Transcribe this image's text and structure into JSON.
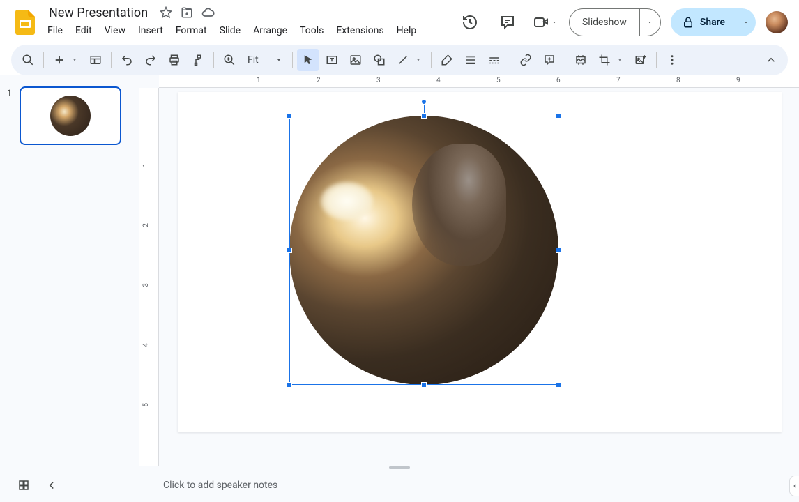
{
  "header": {
    "doc_title": "New Presentation",
    "menu": [
      "File",
      "Edit",
      "View",
      "Insert",
      "Format",
      "Slide",
      "Arrange",
      "Tools",
      "Extensions",
      "Help"
    ],
    "slideshow_label": "Slideshow",
    "share_label": "Share"
  },
  "toolbar": {
    "zoom_label": "Fit"
  },
  "slides": {
    "items": [
      {
        "num": "1"
      }
    ]
  },
  "ruler_h": [
    "1",
    "2",
    "3",
    "4",
    "5",
    "6",
    "7",
    "8",
    "9"
  ],
  "ruler_v": [
    "1",
    "2",
    "3",
    "4",
    "5"
  ],
  "notes": {
    "placeholder": "Click to add speaker notes"
  }
}
